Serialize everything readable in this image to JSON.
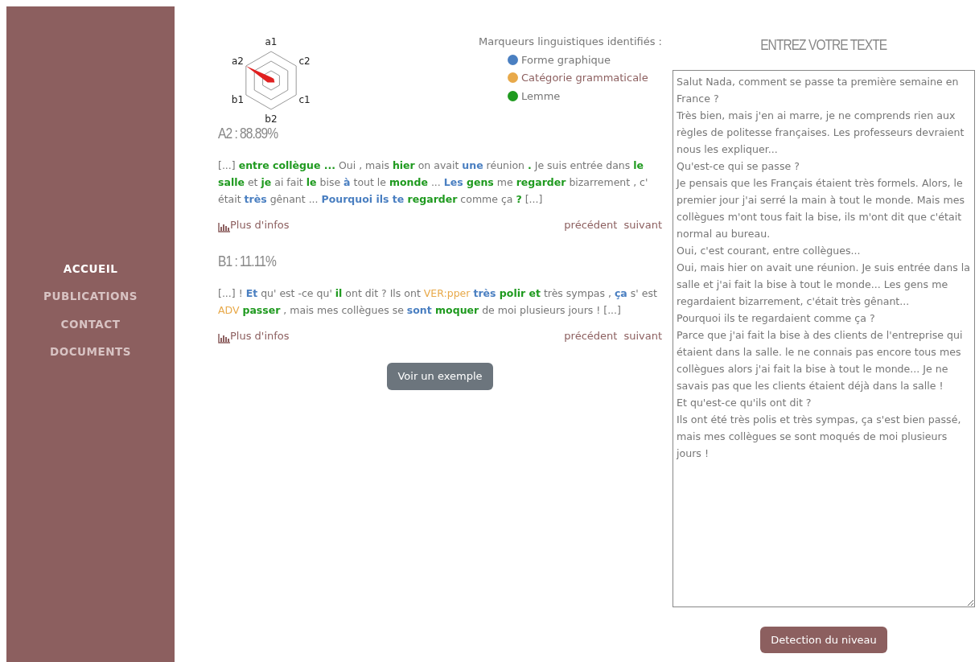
{
  "sidebar": {
    "items": [
      {
        "label": "ACCUEIL",
        "selected": true
      },
      {
        "label": "PUBLICATIONS",
        "selected": false
      },
      {
        "label": "CONTACT",
        "selected": false
      },
      {
        "label": "DOCUMENTS",
        "selected": false
      }
    ]
  },
  "radar": {
    "axes": [
      "a1",
      "c2",
      "c1",
      "b2",
      "b1",
      "a2"
    ]
  },
  "legend": {
    "title": "Marqueurs linguistiques identifiés :",
    "items": [
      {
        "label": "Forme graphique",
        "color": "#4a7fc1",
        "selected": false
      },
      {
        "label": "Catégorie grammaticale",
        "color": "#e8a94a",
        "selected": true
      },
      {
        "label": "Lemme",
        "color": "#1f9a1f",
        "selected": false
      }
    ]
  },
  "results": [
    {
      "score": "A2 : 88.89%",
      "segments": [
        {
          "text": "[...] ",
          "kind": "plain"
        },
        {
          "text": "entre collègue ...",
          "kind": "lemma"
        },
        {
          "text": " Oui , mais ",
          "kind": "plain"
        },
        {
          "text": "hier",
          "kind": "lemma"
        },
        {
          "text": " on avait ",
          "kind": "plain"
        },
        {
          "text": "une",
          "kind": "form"
        },
        {
          "text": " réunion ",
          "kind": "plain"
        },
        {
          "text": ".",
          "kind": "lemma"
        },
        {
          "text": " Je suis entrée dans ",
          "kind": "plain"
        },
        {
          "text": "le salle",
          "kind": "lemma"
        },
        {
          "text": " et ",
          "kind": "plain"
        },
        {
          "text": "je",
          "kind": "lemma"
        },
        {
          "text": " ai fait ",
          "kind": "plain"
        },
        {
          "text": "le",
          "kind": "lemma"
        },
        {
          "text": " bise ",
          "kind": "plain"
        },
        {
          "text": "à",
          "kind": "form"
        },
        {
          "text": " tout le ",
          "kind": "plain"
        },
        {
          "text": "monde",
          "kind": "lemma"
        },
        {
          "text": " ... ",
          "kind": "plain"
        },
        {
          "text": "Les ",
          "kind": "form"
        },
        {
          "text": "gens",
          "kind": "lemma"
        },
        {
          "text": " me ",
          "kind": "plain"
        },
        {
          "text": "regarder",
          "kind": "lemma"
        },
        {
          "text": " bizarrement , c' était ",
          "kind": "plain"
        },
        {
          "text": "très",
          "kind": "form"
        },
        {
          "text": " gênant ... ",
          "kind": "plain"
        },
        {
          "text": "Pourquoi ils te ",
          "kind": "form"
        },
        {
          "text": "regarder",
          "kind": "lemma"
        },
        {
          "text": " comme ça ",
          "kind": "plain"
        },
        {
          "text": "?",
          "kind": "lemma"
        },
        {
          "text": " [...]",
          "kind": "plain"
        }
      ],
      "more": "Plus d'infos",
      "prev": "précédent",
      "next": "suivant"
    },
    {
      "score": "B1 : 11.11%",
      "segments": [
        {
          "text": "[...] ! ",
          "kind": "plain"
        },
        {
          "text": "Et",
          "kind": "form"
        },
        {
          "text": " qu' est -ce qu' ",
          "kind": "plain"
        },
        {
          "text": "il",
          "kind": "lemma"
        },
        {
          "text": " ont dit ? Ils ont ",
          "kind": "plain"
        },
        {
          "text": "VER:pper ",
          "kind": "category"
        },
        {
          "text": "très ",
          "kind": "form"
        },
        {
          "text": "polir et",
          "kind": "lemma"
        },
        {
          "text": " très sympas , ",
          "kind": "plain"
        },
        {
          "text": "ça",
          "kind": "form"
        },
        {
          "text": " s' est ",
          "kind": "plain"
        },
        {
          "text": "ADV ",
          "kind": "category"
        },
        {
          "text": "passer",
          "kind": "lemma"
        },
        {
          "text": " , mais mes collègues se ",
          "kind": "plain"
        },
        {
          "text": "sont ",
          "kind": "form"
        },
        {
          "text": "moquer",
          "kind": "lemma"
        },
        {
          "text": " de moi plusieurs jours ! [...]",
          "kind": "plain"
        }
      ],
      "more": "Plus d'infos",
      "prev": "précédent",
      "next": "suivant"
    }
  ],
  "example_button": "Voir un exemple",
  "input": {
    "title": "ENTREZ VOTRE TEXTE",
    "value": "Salut Nada, comment se passe ta première semaine en France ?\nTrès bien, mais j'en ai marre, je ne comprends rien aux règles de politesse françaises. Les professeurs devraient nous les expliquer...\nQu'est-ce qui se passe ?\nJe pensais que les Français étaient très formels. Alors, le premier jour j'ai serré la main à tout le monde. Mais mes collègues m'ont tous fait la bise, ils m'ont dit que c'était normal au bureau.\nOui, c'est courant, entre collègues...\nOui, mais hier on avait une réunion. Je suis entrée dans la salle et j'ai fait la bise à tout le monde... Les gens me regardaient bizarrement, c'était très gênant...\nPourquoi ils te regardaient comme ça ?\nParce que j'ai fait la bise à des clients de l'entreprise qui étaient dans la salle. le ne connais pas encore tous mes collègues alors j'ai fait la bise à tout le monde... Je ne savais pas que les clients étaient déjà dans la salle !\nEt qu'est-ce qu'ils ont dit ?\nIls ont été très polis et très sympas, ça s'est bien passé, mais mes collègues se sont moqués de moi plusieurs jours !",
    "button": "Detection du niveau"
  }
}
